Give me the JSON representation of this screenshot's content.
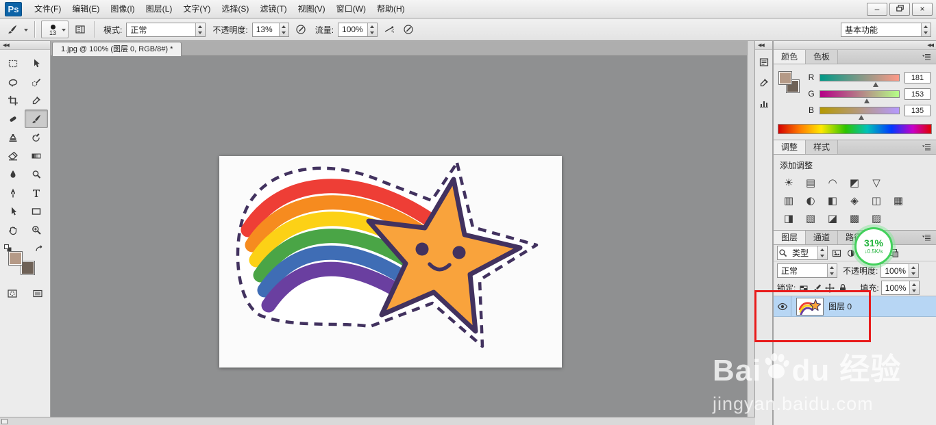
{
  "window": {
    "logo_text": "Ps",
    "controls": {
      "minimize": "–",
      "close": "×"
    }
  },
  "menu_bar": {
    "items": [
      "文件(F)",
      "编辑(E)",
      "图像(I)",
      "图层(L)",
      "文字(Y)",
      "选择(S)",
      "滤镜(T)",
      "视图(V)",
      "窗口(W)",
      "帮助(H)"
    ]
  },
  "options_bar": {
    "brush_size": "13",
    "mode_label": "模式:",
    "mode_value": "正常",
    "opacity_label": "不透明度:",
    "opacity_value": "13%",
    "flow_label": "流量:",
    "flow_value": "100%",
    "workspace_label": "基本功能"
  },
  "toolbar": {
    "tools": [
      {
        "name": "rectangular-marquee"
      },
      {
        "name": "move"
      },
      {
        "name": "lasso"
      },
      {
        "name": "quick-selection"
      },
      {
        "name": "crop"
      },
      {
        "name": "eyedropper"
      },
      {
        "name": "spot-healing-brush"
      },
      {
        "name": "brush",
        "selected": true
      },
      {
        "name": "clone-stamp"
      },
      {
        "name": "history-brush"
      },
      {
        "name": "eraser"
      },
      {
        "name": "gradient"
      },
      {
        "name": "blur"
      },
      {
        "name": "dodge"
      },
      {
        "name": "pen"
      },
      {
        "name": "type"
      },
      {
        "name": "path-selection"
      },
      {
        "name": "shape"
      },
      {
        "name": "hand"
      },
      {
        "name": "zoom"
      }
    ],
    "foreground_color": "#b59a87",
    "background_color": "#6e6156"
  },
  "document": {
    "tab_title": "1.jpg @ 100% (图层 0, RGB/8#) *"
  },
  "collapsed_dock": {
    "icons": [
      {
        "name": "properties-panel",
        "icon": "properties-panel"
      },
      {
        "name": "info-panel",
        "icon": "eyedropper"
      },
      {
        "name": "histogram-panel",
        "icon": "histogram-panel"
      }
    ]
  },
  "color_panel": {
    "tab_color": "颜色",
    "tab_swatches": "色板",
    "max": 255,
    "channels": [
      {
        "label": "R",
        "value": "181",
        "gradient": [
          "#009987",
          "#ff9987"
        ]
      },
      {
        "label": "G",
        "value": "153",
        "gradient": [
          "#b50087",
          "#b5ff87"
        ]
      },
      {
        "label": "B",
        "value": "135",
        "gradient": [
          "#b59900",
          "#b599ff"
        ]
      }
    ]
  },
  "adjustments_panel": {
    "tab_adjustments": "调整",
    "tab_styles": "样式",
    "title": "添加调整",
    "rows": [
      [
        {
          "name": "brightness-contrast",
          "glyph": "☀"
        },
        {
          "name": "levels",
          "glyph": "▤"
        },
        {
          "name": "curves",
          "glyph": "◠"
        },
        {
          "name": "exposure",
          "glyph": "◩"
        },
        {
          "name": "vibrance",
          "glyph": "▽"
        }
      ],
      [
        {
          "name": "hue-saturation",
          "glyph": "▥"
        },
        {
          "name": "color-balance",
          "glyph": "◐"
        },
        {
          "name": "black-white",
          "glyph": "◧"
        },
        {
          "name": "photo-filter",
          "glyph": "◈"
        },
        {
          "name": "channel-mixer",
          "glyph": "◫"
        },
        {
          "name": "color-lookup",
          "glyph": "▦"
        }
      ],
      [
        {
          "name": "invert",
          "glyph": "◨"
        },
        {
          "name": "posterize",
          "glyph": "▧"
        },
        {
          "name": "threshold",
          "glyph": "◪"
        },
        {
          "name": "gradient-map",
          "glyph": "▩"
        },
        {
          "name": "selective-color",
          "glyph": "▨"
        }
      ]
    ]
  },
  "layers_panel": {
    "tab_layers": "图层",
    "tab_channels": "通道",
    "tab_paths": "路径",
    "filter_value": "类型",
    "filter_icons": [
      {
        "name": "pixel-layer-filter",
        "icon": "image-filter"
      },
      {
        "name": "adjustment-layer-filter",
        "icon": "adjustment-filter"
      },
      {
        "name": "type-layer-filter",
        "icon": "type-filter"
      },
      {
        "name": "shape-layer-filter",
        "icon": "shape-filter"
      },
      {
        "name": "smart-object-filter",
        "icon": "smart-filter"
      }
    ],
    "blend_mode": "正常",
    "opacity_label": "不透明度:",
    "opacity_value": "100%",
    "lock_label": "锁定:",
    "lock_icons": [
      {
        "name": "lock-transparent-pixels",
        "icon": "checker"
      },
      {
        "name": "lock-image-pixels",
        "icon": "brush-small"
      },
      {
        "name": "lock-position",
        "icon": "move-lock"
      },
      {
        "name": "lock-all",
        "icon": "lock"
      }
    ],
    "fill_label": "填充:",
    "fill_value": "100%",
    "layers": [
      {
        "name": "图层 0",
        "selected": true
      }
    ]
  },
  "recorder_badge": {
    "percent": "31%",
    "arrow": "↓",
    "speed": "0.5K/s"
  },
  "watermark": {
    "brand_prefix": "Bai",
    "brand_suffix": "du",
    "brand_cn": "经验",
    "url": "jingyan.baidu.com"
  },
  "chrome": {
    "collapse_arrows": "◀◀"
  },
  "artwork": {
    "rainbow_colors": [
      "#ee3e36",
      "#f68b1f",
      "#fcd116",
      "#4aa546",
      "#3f6db5",
      "#6a3fa0"
    ],
    "star_fill": "#f9a33c",
    "outline_color": "#42325f"
  }
}
